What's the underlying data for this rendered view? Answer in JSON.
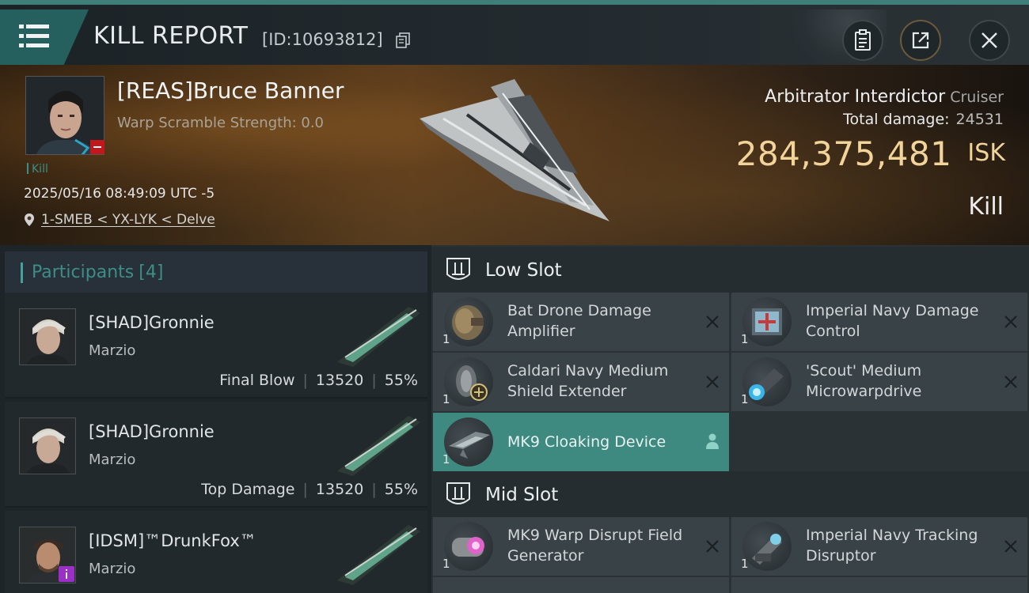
{
  "header": {
    "title": "KILL REPORT",
    "report_id": "[ID:10693812]"
  },
  "victim": {
    "name": "[REAS]Bruce Banner",
    "warp_scramble": "Warp Scramble Strength: 0.0",
    "kill_tag": "Kill",
    "timestamp": "2025/05/16 08:49:09 UTC -5",
    "location": "1-SMEB < YX-LYK < Delve",
    "ship_name": "Arbitrator Interdictor",
    "ship_class": "Cruiser",
    "total_damage_label": "Total damage:",
    "total_damage_value": "24531",
    "isk_value": "284,375,481",
    "isk_unit": "ISK",
    "result": "Kill"
  },
  "participants": {
    "title": "Participants",
    "count": "[4]",
    "rows": [
      {
        "name": "[SHAD]Gronnie",
        "ship": "Marzio",
        "role": "Final Blow",
        "damage": "13520",
        "percent": "55%"
      },
      {
        "name": "[SHAD]Gronnie",
        "ship": "Marzio",
        "role": "Top Damage",
        "damage": "13520",
        "percent": "55%"
      },
      {
        "name": "[IDSM]™DrunkFox™",
        "ship": "Marzio"
      }
    ]
  },
  "fittings": {
    "low_slot_title": "Low Slot",
    "mid_slot_title": "Mid Slot",
    "low_slot": [
      {
        "name": "Bat Drone Damage Amplifier",
        "qty": "1"
      },
      {
        "name": "Imperial Navy Damage Control",
        "qty": "1"
      },
      {
        "name": "Caldari Navy Medium Shield Extender",
        "qty": "1"
      },
      {
        "name": "'Scout' Medium Microwarpdrive",
        "qty": "1"
      },
      {
        "name": "MK9 Cloaking Device",
        "qty": "1"
      }
    ],
    "mid_slot": [
      {
        "name": "MK9 Warp Disrupt Field Generator",
        "qty": "1"
      },
      {
        "name": "Imperial Navy Tracking Disruptor",
        "qty": "1"
      }
    ]
  },
  "colors": {
    "accent": "#3f8a80",
    "isk": "#f2d49b",
    "header_tab": "#25605f",
    "remove_badge": "#c0181b"
  },
  "icons": {
    "menu": "menu-icon",
    "copy": "copy-icon",
    "clipboard": "clipboard-icon",
    "share": "share-icon",
    "close": "close-icon",
    "location": "location-pin-icon",
    "slot": "slot-icon",
    "remove": "x-icon",
    "person": "person-icon"
  }
}
